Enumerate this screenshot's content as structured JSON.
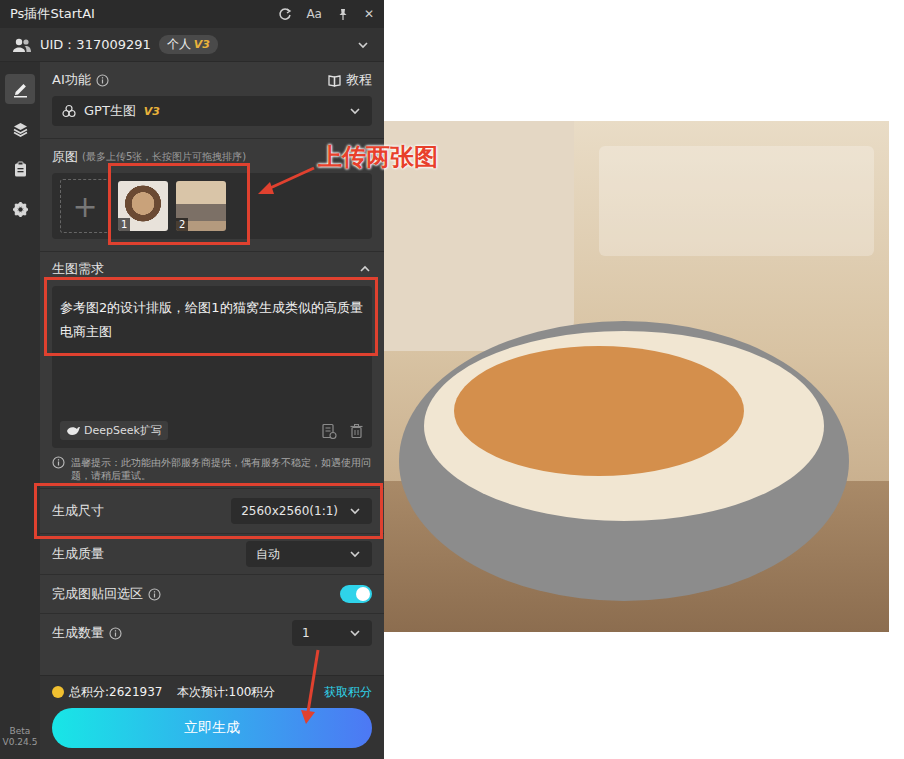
{
  "window": {
    "title": "Ps插件StartAI",
    "font_button": "Aa",
    "close": "✕"
  },
  "user": {
    "uid": "UID：317009291",
    "plan": "个人",
    "level": "V3"
  },
  "sidebar": {
    "items": [
      {
        "selected": true
      },
      {
        "selected": false
      },
      {
        "selected": false
      },
      {
        "selected": false
      }
    ],
    "beta": "Beta",
    "version": "V0.24.5"
  },
  "ai_function": {
    "label": "AI功能",
    "tutorial": "教程",
    "model": "GPT生图",
    "model_badge": "V3"
  },
  "source_images": {
    "label": "原图",
    "hint": "(最多上传5张，长按图片可拖拽排序)",
    "add": "+",
    "thumbs": [
      {
        "number": "1"
      },
      {
        "number": "2"
      }
    ]
  },
  "prompt": {
    "label": "生图需求",
    "expanded": true,
    "value": "参考图2的设计排版，给图1的猫窝生成类似的高质量电商主图",
    "expand_button": "DeepSeek扩写"
  },
  "notice": "温馨提示：此功能由外部服务商提供，偶有服务不稳定，如遇使用问题，请稍后重试。",
  "settings": [
    {
      "kind": "select",
      "label": "生成尺寸",
      "info": false,
      "value": "2560x2560(1:1)"
    },
    {
      "kind": "select",
      "label": "生成质量",
      "info": false,
      "value": "自动"
    },
    {
      "kind": "toggle",
      "label": "完成图贴回选区",
      "info": true,
      "on": true
    },
    {
      "kind": "select",
      "label": "生成数量",
      "info": true,
      "value": "1"
    }
  ],
  "footer": {
    "total": "总积分:2621937",
    "estimate": "本次预计:100积分",
    "get_credits": "获取积分",
    "generate": "立即生成"
  },
  "annotation": {
    "label": "上传两张图"
  }
}
